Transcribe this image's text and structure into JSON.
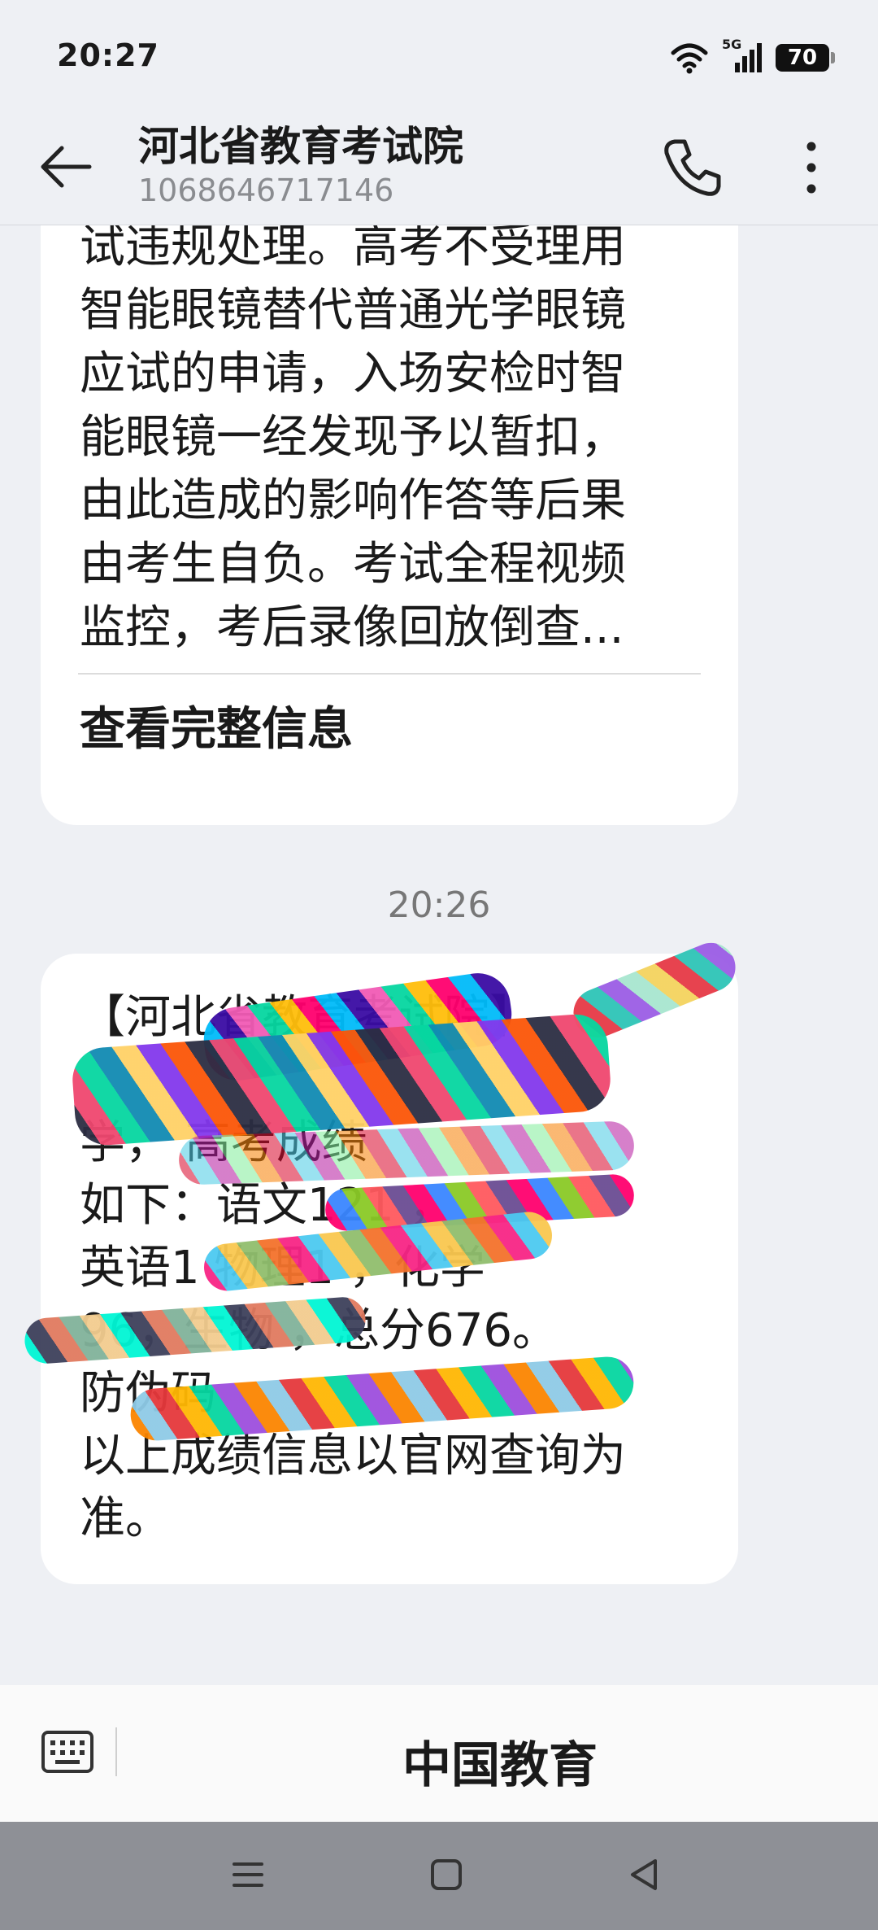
{
  "status_bar": {
    "time": "20:27",
    "network": "5G",
    "battery": "70"
  },
  "header": {
    "title": "河北省教育考试院",
    "number": "1068646717146"
  },
  "messages": [
    {
      "text": "试违规处理。高考不受理用\n智能眼镜替代普通光学眼镜\n应试的申请，入场安检时智\n能眼镜一经发现予以暂扣，\n由此造成的影响作答等后果\n由考生自负。考试全程视频\n监控，考后录像回放倒查...",
      "link": "查看完整信息"
    },
    {
      "timestamp": "20:26",
      "text": "【河北省教育考试院】\n\n学，        高考成绩\n如下：语文121       ，\n英语1   物理1   ，化学\n96，生物  ，总分676。\n防伪码\n以上成绩信息以官网查询为\n准。"
    }
  ],
  "input_bar": {
    "recipient": "中国教育"
  },
  "nav_icons": [
    "menu-icon",
    "home-icon",
    "back-icon"
  ],
  "colors": {
    "background": "#eef0f4",
    "bubble": "#ffffff",
    "navbar": "#8e9096"
  }
}
